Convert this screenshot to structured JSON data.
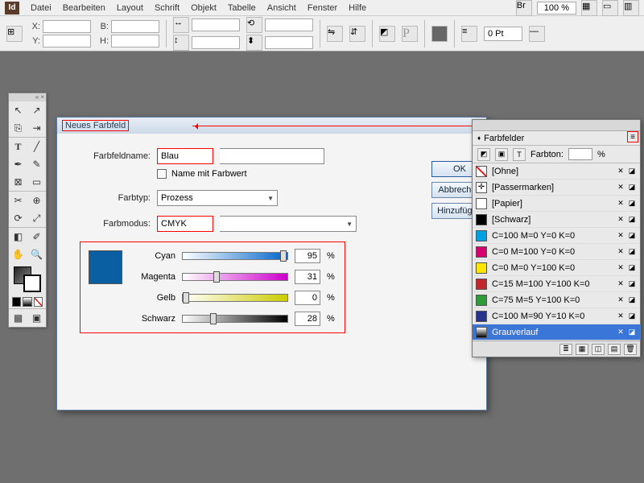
{
  "menu": {
    "items": [
      "Datei",
      "Bearbeiten",
      "Layout",
      "Schrift",
      "Objekt",
      "Tabelle",
      "Ansicht",
      "Fenster",
      "Hilfe"
    ],
    "zoom": "100 %"
  },
  "controlbar": {
    "x": "X:",
    "y": "Y:",
    "b": "B:",
    "h": "H:",
    "pt": "0 Pt"
  },
  "dialog": {
    "title": "Neues Farbfeld",
    "name_label": "Farbfeldname:",
    "name_value": "Blau",
    "name_with_value": "Name mit Farbwert",
    "type_label": "Farbtyp:",
    "type_value": "Prozess",
    "mode_label": "Farbmodus:",
    "mode_value": "CMYK",
    "channels": {
      "cyan": {
        "label": "Cyan",
        "value": "95"
      },
      "magenta": {
        "label": "Magenta",
        "value": "31"
      },
      "yellow": {
        "label": "Gelb",
        "value": "0"
      },
      "black": {
        "label": "Schwarz",
        "value": "28"
      }
    },
    "pct": "%",
    "buttons": {
      "ok": "OK",
      "cancel": "Abbrechen",
      "add": "Hinzufügen"
    }
  },
  "panel": {
    "title": "Farbfelder",
    "tint_label": "Farbton:",
    "tint_unit": "%",
    "rows": [
      {
        "name": "[Ohne]",
        "chip": "none"
      },
      {
        "name": "[Passermarken]",
        "chip": "reg"
      },
      {
        "name": "[Papier]",
        "chip": "#ffffff"
      },
      {
        "name": "[Schwarz]",
        "chip": "#000000"
      },
      {
        "name": "C=100 M=0 Y=0 K=0",
        "chip": "#00a0e3"
      },
      {
        "name": "C=0 M=100 Y=0 K=0",
        "chip": "#d6006c"
      },
      {
        "name": "C=0 M=0 Y=100 K=0",
        "chip": "#ffe600"
      },
      {
        "name": "C=15 M=100 Y=100 K=0",
        "chip": "#c1272d"
      },
      {
        "name": "C=75 M=5 Y=100 K=0",
        "chip": "#2e9b3a"
      },
      {
        "name": "C=100 M=90 Y=10 K=0",
        "chip": "#27348b"
      },
      {
        "name": "Grauverlauf",
        "chip": "grad",
        "selected": true
      }
    ]
  }
}
